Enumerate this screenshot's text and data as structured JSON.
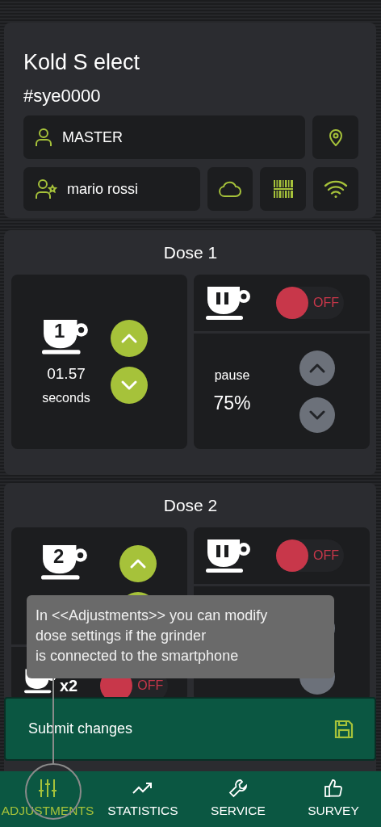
{
  "device": {
    "name": "Kold S elect",
    "code": "#sye0000",
    "role": "MASTER",
    "user": "mario rossi"
  },
  "doses": [
    {
      "title": "Dose 1",
      "cup_number": "1",
      "value": "01.57",
      "unit": "seconds",
      "pause": {
        "on": false,
        "toggle_label": "OFF",
        "label": "pause",
        "value": "75%"
      }
    },
    {
      "title": "Dose 2",
      "cup_number": "2",
      "pause": {
        "on": false,
        "toggle_label": "OFF"
      },
      "double": {
        "label": "x2",
        "on": false,
        "toggle_label": "OFF"
      }
    }
  ],
  "submit": {
    "label": "Submit changes"
  },
  "tooltip": {
    "text": "In <<Adjustments>> you can modify\ndose settings if the grinder\nis connected to the smartphone"
  },
  "nav": [
    {
      "label": "ADJUSTMENTS",
      "selected": true
    },
    {
      "label": "STATISTICS",
      "selected": false
    },
    {
      "label": "SERVICE",
      "selected": false
    },
    {
      "label": "SURVEY",
      "selected": false
    }
  ]
}
